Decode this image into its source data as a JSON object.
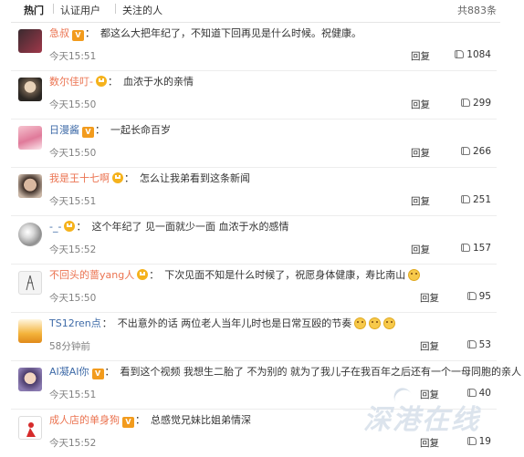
{
  "tabs": {
    "hot": "热门",
    "verified": "认证用户",
    "following": "关注的人"
  },
  "total_count": "共883条",
  "reply_label": "回复",
  "comments": [
    {
      "user": "急叔",
      "badge": "v",
      "text": "都这么大把年纪了，不知道下回再见是什么时候。祝健康。",
      "time": "今天15:51",
      "likes": "1084"
    },
    {
      "user": "数尔佳叮-",
      "badge": "crown",
      "text": "血浓于水的亲情",
      "time": "今天15:50",
      "likes": "299"
    },
    {
      "user": "日漫酱",
      "badge": "v",
      "text": "一起长命百岁",
      "time": "今天15:50",
      "likes": "266"
    },
    {
      "user": "我是王十七啊",
      "badge": "crown",
      "text": "怎么让我弟看到这条新闻",
      "time": "今天15:51",
      "likes": "251"
    },
    {
      "user": "-_-",
      "badge": "crown",
      "text": "这个年纪了 见一面就少一面 血浓于水的感情",
      "time": "今天15:52",
      "likes": "157"
    },
    {
      "user": "不回头的蔷yang人",
      "badge": "crown",
      "text": "下次见面不知是什么时候了，祝愿身体健康，寿比南山",
      "emojis": 1,
      "time": "今天15:50",
      "likes": "95"
    },
    {
      "user": "TS12ren点",
      "badge": "",
      "text": "不出意外的话 两位老人当年儿时也是日常互殴的节奏",
      "emojis": 3,
      "time": "58分钟前",
      "likes": "53"
    },
    {
      "user": "AI凝AI你",
      "badge": "v",
      "text": "看到这个视频 我想生二胎了 不为别的 就为了我儿子在我百年之后还有一个一母同胞的亲人",
      "heart": true,
      "time": "今天15:51",
      "likes": "40"
    },
    {
      "user": "成人店的单身狗",
      "badge": "v",
      "text": "总感觉兄妹比姐弟情深",
      "time": "今天15:52",
      "likes": "19"
    }
  ],
  "watermark": "深港在线",
  "colors": {
    "username": "#eb7350",
    "username_alt": "#3f6ba8",
    "verified_badge": "#f29b1d",
    "timestamp": "#808080"
  }
}
